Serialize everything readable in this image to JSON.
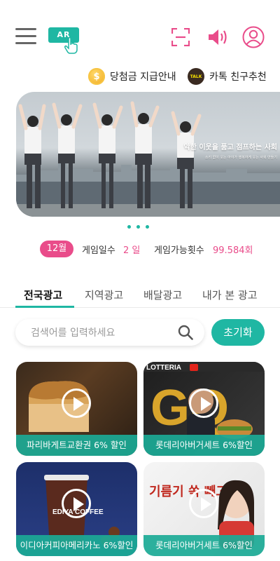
{
  "header": {
    "ar_label": "AR"
  },
  "notices": {
    "prize_info": "당첨금 지급안내",
    "kakao_recommend": "카톡 친구추천",
    "coin_symbol": "$",
    "talk_symbol": "TALK"
  },
  "banner": {
    "title": "악한 이웃을 품고 점프하는 사회",
    "subtitle": "소리 없이 웃는 아이가 행복하게 웃는 사회 만들기"
  },
  "stats": {
    "month": "12월",
    "game_days_label": "게임일수",
    "game_days_value": "2 일",
    "game_count_label": "게임가능횟수",
    "game_count_value": "99.584회"
  },
  "tabs": [
    "전국광고",
    "지역광고",
    "배달광고",
    "내가 본 광고"
  ],
  "search": {
    "placeholder": "검색어를 입력하세요",
    "reset_label": "초기화"
  },
  "cards": [
    {
      "label": "파리바게트교환권 6% 할인",
      "image": "bread"
    },
    {
      "label": "롯데리아버거세트 6%할인",
      "image": "lotteria-burger",
      "brand": "LOTTERIA"
    },
    {
      "label": "이디아커피아메리카노 6%할인",
      "image": "ediya-coffee",
      "brand": "EDIYA COFFEE"
    },
    {
      "label": "롯데리아버거세트 6%할인",
      "image": "lotteria-woman",
      "ad_text": "기름기 쏙 빼고"
    }
  ],
  "colors": {
    "accent": "#1fb7a3",
    "pink": "#e94c8a"
  }
}
